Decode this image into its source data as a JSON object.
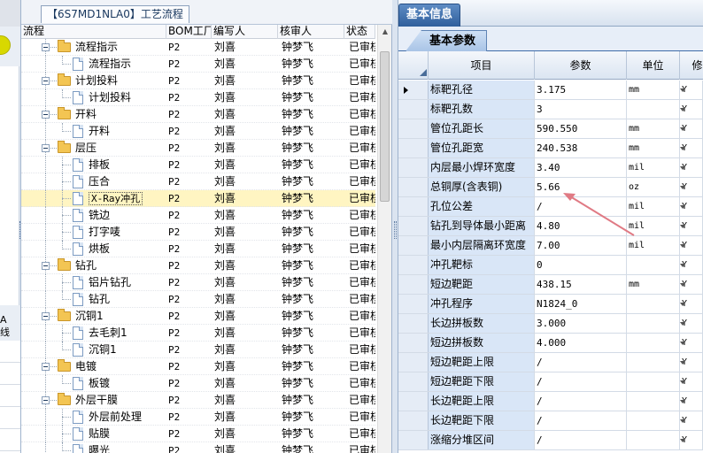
{
  "left_strip": {
    "frag1": "A",
    "frag2": "线"
  },
  "tree_panel": {
    "tab_label": "【6S7MD1NLA0】工艺流程",
    "columns": [
      "流程",
      "BOM工厂",
      "编写人",
      "核审人",
      "状态"
    ],
    "rows": [
      {
        "level": 0,
        "type": "folder",
        "name": "流程指示",
        "bom": "P2",
        "writer": "刘喜",
        "reviewer": "钟梦飞",
        "status": "已审核"
      },
      {
        "level": 1,
        "type": "doc",
        "name": "流程指示",
        "bom": "P2",
        "writer": "刘喜",
        "reviewer": "钟梦飞",
        "status": "已审核"
      },
      {
        "level": 0,
        "type": "folder",
        "name": "计划投料",
        "bom": "P2",
        "writer": "刘喜",
        "reviewer": "钟梦飞",
        "status": "已审核"
      },
      {
        "level": 1,
        "type": "doc",
        "name": "计划投料",
        "bom": "P2",
        "writer": "刘喜",
        "reviewer": "钟梦飞",
        "status": "已审核"
      },
      {
        "level": 0,
        "type": "folder",
        "name": "开料",
        "bom": "P2",
        "writer": "刘喜",
        "reviewer": "钟梦飞",
        "status": "已审核"
      },
      {
        "level": 1,
        "type": "doc",
        "name": "开料",
        "bom": "P2",
        "writer": "刘喜",
        "reviewer": "钟梦飞",
        "status": "已审核"
      },
      {
        "level": 0,
        "type": "folder",
        "name": "层压",
        "bom": "P2",
        "writer": "刘喜",
        "reviewer": "钟梦飞",
        "status": "已审核"
      },
      {
        "level": 1,
        "type": "doc",
        "name": "排板",
        "bom": "P2",
        "writer": "刘喜",
        "reviewer": "钟梦飞",
        "status": "已审核"
      },
      {
        "level": 1,
        "type": "doc",
        "name": "压合",
        "bom": "P2",
        "writer": "刘喜",
        "reviewer": "钟梦飞",
        "status": "已审核"
      },
      {
        "level": 1,
        "type": "doc",
        "name": "X-Ray冲孔",
        "bom": "P2",
        "writer": "刘喜",
        "reviewer": "钟梦飞",
        "status": "已审核",
        "selected": true
      },
      {
        "level": 1,
        "type": "doc",
        "name": "铣边",
        "bom": "P2",
        "writer": "刘喜",
        "reviewer": "钟梦飞",
        "status": "已审核"
      },
      {
        "level": 1,
        "type": "doc",
        "name": "打字唛",
        "bom": "P2",
        "writer": "刘喜",
        "reviewer": "钟梦飞",
        "status": "已审核"
      },
      {
        "level": 1,
        "type": "doc",
        "name": "烘板",
        "bom": "P2",
        "writer": "刘喜",
        "reviewer": "钟梦飞",
        "status": "已审核"
      },
      {
        "level": 0,
        "type": "folder",
        "name": "钻孔",
        "bom": "P2",
        "writer": "刘喜",
        "reviewer": "钟梦飞",
        "status": "已审核"
      },
      {
        "level": 1,
        "type": "doc",
        "name": "铝片钻孔",
        "bom": "P2",
        "writer": "刘喜",
        "reviewer": "钟梦飞",
        "status": "已审核"
      },
      {
        "level": 1,
        "type": "doc",
        "name": "钻孔",
        "bom": "P2",
        "writer": "刘喜",
        "reviewer": "钟梦飞",
        "status": "已审核"
      },
      {
        "level": 0,
        "type": "folder",
        "name": "沉铜1",
        "bom": "P2",
        "writer": "刘喜",
        "reviewer": "钟梦飞",
        "status": "已审核"
      },
      {
        "level": 1,
        "type": "doc",
        "name": "去毛刺1",
        "bom": "P2",
        "writer": "刘喜",
        "reviewer": "钟梦飞",
        "status": "已审核"
      },
      {
        "level": 1,
        "type": "doc",
        "name": "沉铜1",
        "bom": "P2",
        "writer": "刘喜",
        "reviewer": "钟梦飞",
        "status": "已审核"
      },
      {
        "level": 0,
        "type": "folder",
        "name": "电镀",
        "bom": "P2",
        "writer": "刘喜",
        "reviewer": "钟梦飞",
        "status": "已审核"
      },
      {
        "level": 1,
        "type": "doc",
        "name": "板镀",
        "bom": "P2",
        "writer": "刘喜",
        "reviewer": "钟梦飞",
        "status": "已审核"
      },
      {
        "level": 0,
        "type": "folder",
        "name": "外层干膜",
        "bom": "P2",
        "writer": "刘喜",
        "reviewer": "钟梦飞",
        "status": "已审核"
      },
      {
        "level": 1,
        "type": "doc",
        "name": "外层前处理",
        "bom": "P2",
        "writer": "刘喜",
        "reviewer": "钟梦飞",
        "status": "已审核"
      },
      {
        "level": 1,
        "type": "doc",
        "name": "贴膜",
        "bom": "P2",
        "writer": "刘喜",
        "reviewer": "钟梦飞",
        "status": "已审核"
      },
      {
        "level": 1,
        "type": "doc",
        "name": "曝光",
        "bom": "P2",
        "writer": "刘喜",
        "reviewer": "钟梦飞",
        "status": "已审核"
      }
    ]
  },
  "right_panel": {
    "title": "基本信息",
    "sub_tab": "基本参数",
    "columns": [
      "项目",
      "参数",
      "单位",
      "修"
    ],
    "rows": [
      {
        "item": "标靶孔径",
        "param": "3.175",
        "unit": "mm",
        "flag": "Y",
        "current": true
      },
      {
        "item": "标靶孔数",
        "param": "3",
        "unit": "",
        "flag": "Y"
      },
      {
        "item": "管位孔距长",
        "param": "590.550",
        "unit": "mm",
        "flag": "Y"
      },
      {
        "item": "管位孔距宽",
        "param": "240.538",
        "unit": "mm",
        "flag": "Y"
      },
      {
        "item": "内层最小焊环宽度",
        "param": "3.40",
        "unit": "mil",
        "flag": "Y"
      },
      {
        "item": "总铜厚(含表铜)",
        "param": "5.66",
        "unit": "oz",
        "flag": "Y"
      },
      {
        "item": "孔位公差",
        "param": "/",
        "unit": "mil",
        "flag": "Y"
      },
      {
        "item": "钻孔到导体最小距离",
        "param": "4.80",
        "unit": "mil",
        "flag": "Y"
      },
      {
        "item": "最小内层隔离环宽度",
        "param": "7.00",
        "unit": "mil",
        "flag": "Y"
      },
      {
        "item": "冲孔靶标",
        "param": "0",
        "unit": "",
        "flag": "Y"
      },
      {
        "item": "短边靶距",
        "param": "438.15",
        "unit": "mm",
        "flag": "Y"
      },
      {
        "item": "冲孔程序",
        "param": "N1824_0",
        "unit": "",
        "flag": "Y"
      },
      {
        "item": "长边拼板数",
        "param": "3.000",
        "unit": "",
        "flag": "Y"
      },
      {
        "item": "短边拼板数",
        "param": "4.000",
        "unit": "",
        "flag": "Y"
      },
      {
        "item": "短边靶距上限",
        "param": "/",
        "unit": "",
        "flag": "Y"
      },
      {
        "item": "短边靶距下限",
        "param": "/",
        "unit": "",
        "flag": "Y"
      },
      {
        "item": "长边靶距上限",
        "param": "/",
        "unit": "",
        "flag": "Y"
      },
      {
        "item": "长边靶距下限",
        "param": "/",
        "unit": "",
        "flag": "Y"
      },
      {
        "item": "涨缩分堆区间",
        "param": "/",
        "unit": "",
        "flag": "Y"
      }
    ]
  }
}
